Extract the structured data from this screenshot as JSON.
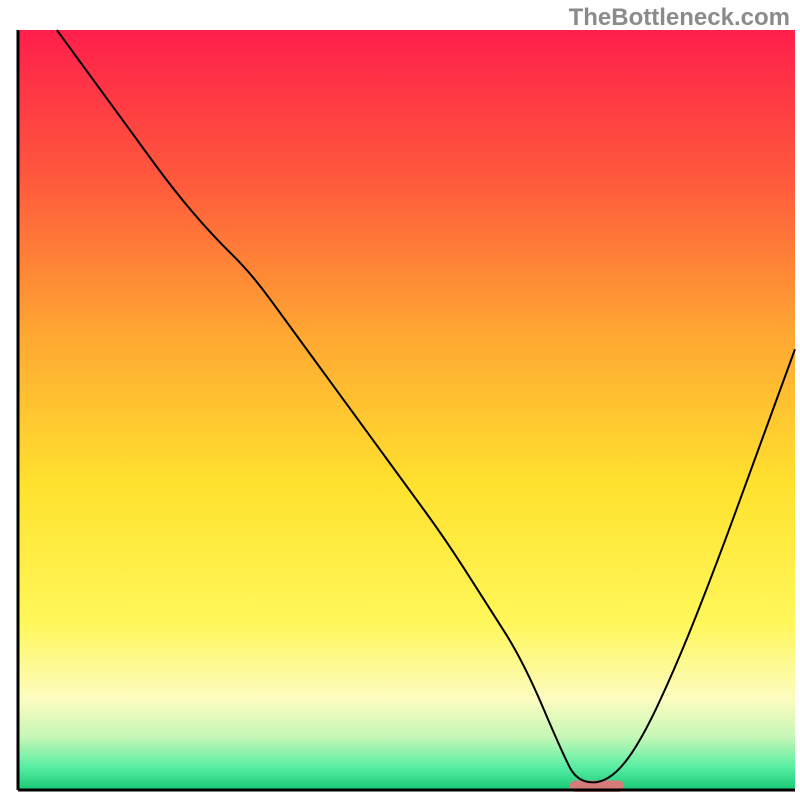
{
  "watermark": {
    "text": "TheBottleneck.com"
  },
  "chart_data": {
    "type": "line",
    "title": "",
    "xlabel": "",
    "ylabel": "",
    "xlim": [
      0,
      100
    ],
    "ylim": [
      0,
      100
    ],
    "grid": false,
    "legend": false,
    "background": {
      "type": "vertical_gradient",
      "stops": [
        {
          "offset": 0.0,
          "color": "#ff1f4b"
        },
        {
          "offset": 0.2,
          "color": "#ff5a3c"
        },
        {
          "offset": 0.4,
          "color": "#ffa732"
        },
        {
          "offset": 0.6,
          "color": "#ffe22e"
        },
        {
          "offset": 0.78,
          "color": "#fff75a"
        },
        {
          "offset": 0.88,
          "color": "#fdfcc0"
        },
        {
          "offset": 0.93,
          "color": "#c6f7b7"
        },
        {
          "offset": 0.97,
          "color": "#57eda2"
        },
        {
          "offset": 1.0,
          "color": "#18c976"
        }
      ]
    },
    "annotations": [
      {
        "type": "segment",
        "name": "highlight-bar",
        "x_start": 71,
        "x_end": 78,
        "y": 0.5,
        "color": "#d77b7a",
        "thickness": 1.5
      }
    ],
    "series": [
      {
        "name": "bottleneck-curve",
        "color": "#000000",
        "stroke_width": 2,
        "x": [
          5,
          10,
          15,
          20,
          25,
          30,
          35,
          40,
          45,
          50,
          55,
          60,
          65,
          70,
          72,
          76,
          80,
          85,
          90,
          95,
          100
        ],
        "y": [
          100,
          93,
          86,
          79,
          73,
          68,
          61,
          54,
          47,
          40,
          33,
          25,
          17,
          5,
          1,
          1,
          6,
          17,
          30,
          44,
          58
        ]
      }
    ]
  }
}
